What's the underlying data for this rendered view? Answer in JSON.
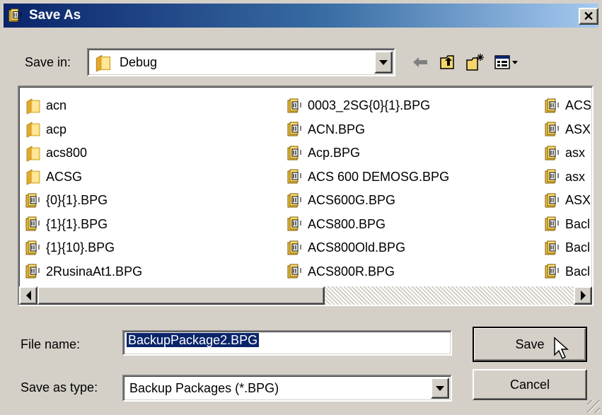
{
  "dialog": {
    "title": "Save As"
  },
  "save_in": {
    "label": "Save in:",
    "value": "Debug"
  },
  "toolbar": {
    "back_icon": "back-arrow-icon",
    "up_icon": "up-folder-icon",
    "new_folder_icon": "new-folder-icon",
    "view_icon": "view-menu-icon"
  },
  "files": {
    "col1": [
      "acn",
      "acp",
      "acs800",
      "ACSG",
      "{0}{1}.BPG",
      "{1}{1}.BPG",
      "{1}{10}.BPG",
      "2RusinaAt1.BPG"
    ],
    "col2": [
      "0003_2SG{0}{1}.BPG",
      "ACN.BPG",
      "Acp.BPG",
      "ACS 600 DEMOSG.BPG",
      "ACS600G.BPG",
      "ACS800.BPG",
      "ACS800Old.BPG",
      "ACS800R.BPG"
    ],
    "col3": [
      "ACS",
      "ASX",
      "asx",
      "asx",
      "ASX",
      "Bacl",
      "Bacl",
      "Bacl"
    ]
  },
  "file_name": {
    "label": "File name:",
    "value": "BackupPackage2.BPG"
  },
  "save_as_type": {
    "label": "Save as type:",
    "value": "Backup Packages (*.BPG)"
  },
  "buttons": {
    "save": "Save",
    "cancel": "Cancel"
  },
  "colors": {
    "title_bar": "#0a246a",
    "face": "#d4d0c8",
    "folder": "#f2c14a",
    "selection": "#0a246a"
  }
}
